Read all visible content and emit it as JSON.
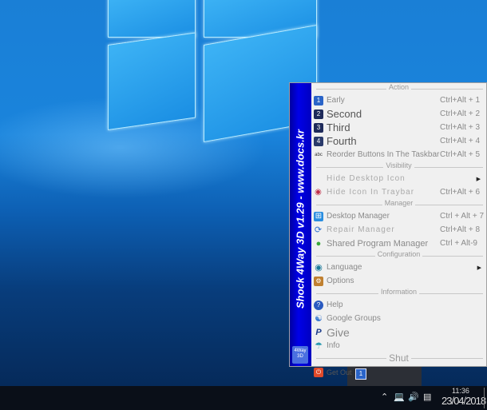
{
  "sidebar": {
    "title": "Shock 4Way 3D  v1.29 - www.docs.kr",
    "logo_text": "4Way 3D"
  },
  "menu": {
    "sections": [
      {
        "label": "Action",
        "items": [
          {
            "icon": "early-icon",
            "glyph": "1",
            "label": "Early",
            "shortcut": "Ctrl+Alt + 1"
          },
          {
            "icon": "second-icon",
            "glyph": "2",
            "label": "Second",
            "shortcut": "Ctrl+Alt + 2"
          },
          {
            "icon": "third-icon",
            "glyph": "3",
            "label": "Third",
            "shortcut": "Ctrl+Alt + 3"
          },
          {
            "icon": "fourth-icon",
            "glyph": "4",
            "label": "Fourth",
            "shortcut": "Ctrl+Alt + 4"
          },
          {
            "icon": "abc-icon",
            "glyph": "abc",
            "label": "Reorder Buttons In The Taskbar",
            "shortcut": "Ctrl+Alt + 5"
          }
        ]
      },
      {
        "label": "Visibility",
        "items": [
          {
            "label": "Hide Desktop Icon",
            "shortcut": "",
            "submenu": true
          },
          {
            "icon": "eye-icon",
            "label": "Hide Icon In Traybar",
            "shortcut": "Ctrl+Alt + 6"
          }
        ]
      },
      {
        "label": "Manager",
        "items": [
          {
            "icon": "windows-icon",
            "label": "Desktop Manager",
            "shortcut": "Ctrl + Alt + 7"
          },
          {
            "icon": "repair-icon",
            "label": "Repair Manager",
            "shortcut": "Ctrl+Alt + 8"
          },
          {
            "icon": "shared-icon",
            "label": "Shared Program Manager",
            "shortcut": "Ctrl + Alt-9"
          }
        ]
      },
      {
        "label": "Configuration",
        "items": [
          {
            "icon": "globe-icon",
            "label": "Language",
            "shortcut": "",
            "submenu": true
          },
          {
            "icon": "options-icon",
            "label": "Options",
            "shortcut": ""
          }
        ]
      },
      {
        "label": "Information",
        "items": [
          {
            "icon": "help-icon",
            "label": "Help",
            "shortcut": ""
          },
          {
            "icon": "google-groups-icon",
            "label": "Google Groups",
            "shortcut": ""
          },
          {
            "icon": "paypal-icon",
            "label": "Give",
            "shortcut": ""
          },
          {
            "icon": "info-icon",
            "label": "Info",
            "shortcut": ""
          }
        ]
      },
      {
        "label": "Shut",
        "items": [
          {
            "icon": "power-icon",
            "label": "Get Out",
            "shortcut": ""
          }
        ]
      }
    ]
  },
  "taskbar": {
    "tray_icon_glyph": "1",
    "clock_time": "11:36",
    "clock_date": "23/04/2018"
  }
}
